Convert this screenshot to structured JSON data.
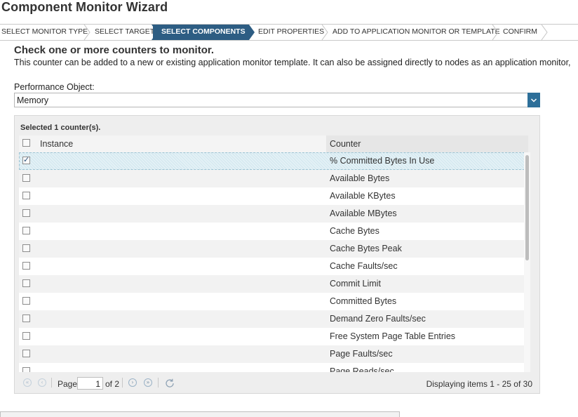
{
  "window": {
    "title": "Component Monitor Wizard"
  },
  "steps": [
    {
      "label": "SELECT MONITOR TYPE",
      "active": false
    },
    {
      "label": "SELECT TARGET",
      "active": false
    },
    {
      "label": "SELECT COMPONENTS",
      "active": true
    },
    {
      "label": "EDIT PROPERTIES",
      "active": false
    },
    {
      "label": "ADD TO APPLICATION MONITOR OR TEMPLATE",
      "active": false
    },
    {
      "label": "CONFIRM",
      "active": false
    }
  ],
  "main": {
    "heading": "Check one or more counters to monitor.",
    "description": "This counter can be added to a new or existing application monitor template. It can also be assigned directly to nodes as an application monitor,",
    "performance_object": {
      "label": "Performance Object:",
      "value": "Memory"
    }
  },
  "grid": {
    "selected_text": "Selected 1 counter(s).",
    "columns": {
      "instance": "Instance",
      "counter": "Counter"
    },
    "rows": [
      {
        "counter": "% Committed Bytes In Use",
        "checked": true
      },
      {
        "counter": "Available Bytes",
        "checked": false
      },
      {
        "counter": "Available KBytes",
        "checked": false
      },
      {
        "counter": "Available MBytes",
        "checked": false
      },
      {
        "counter": "Cache Bytes",
        "checked": false
      },
      {
        "counter": "Cache Bytes Peak",
        "checked": false
      },
      {
        "counter": "Cache Faults/sec",
        "checked": false
      },
      {
        "counter": "Commit Limit",
        "checked": false
      },
      {
        "counter": "Committed Bytes",
        "checked": false
      },
      {
        "counter": "Demand Zero Faults/sec",
        "checked": false
      },
      {
        "counter": "Free System Page Table Entries",
        "checked": false
      },
      {
        "counter": "Page Faults/sec",
        "checked": false
      },
      {
        "counter": "Page Reads/sec",
        "checked": false
      }
    ]
  },
  "pager": {
    "page_label": "Page",
    "page_value": "1",
    "of_label": "of 2",
    "display_info": "Displaying items 1 - 25 of 30",
    "icons": [
      "first-page-icon",
      "prev-page-icon",
      "next-page-icon",
      "last-page-icon",
      "refresh-icon"
    ]
  },
  "colors": {
    "active_step": "#2d5d83",
    "dropdown_button": "#2d6f99",
    "selected_row": "#e3f1f6"
  }
}
